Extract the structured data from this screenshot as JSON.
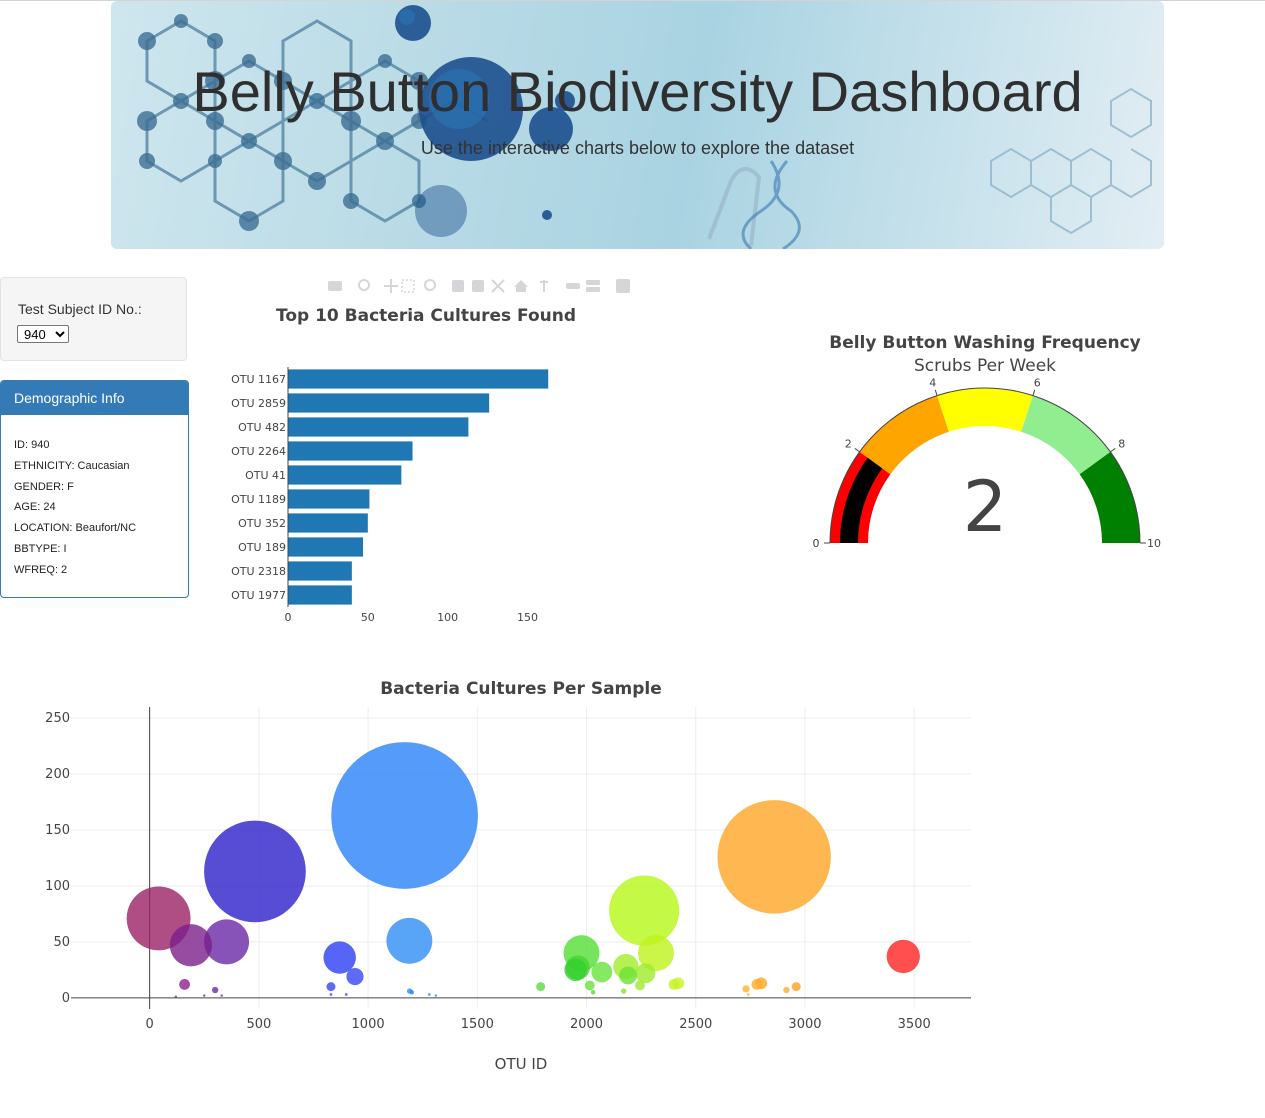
{
  "header": {
    "title": "Belly Button Biodiversity Dashboard",
    "subtitle": "Use the interactive charts below to explore the dataset"
  },
  "selector": {
    "label": "Test Subject ID No.:",
    "selected": "940"
  },
  "demographics": {
    "title": "Demographic Info",
    "rows": [
      "ID: 940",
      "ETHNICITY: Caucasian",
      "GENDER: F",
      "AGE: 24",
      "LOCATION: Beaufort/NC",
      "BBTYPE: I",
      "WFREQ: 2"
    ]
  },
  "colors": {
    "bar": "#1f77b4",
    "panel": "#337ab7",
    "gauge_needle": "#000000",
    "gauge_value_track": "#ff0000"
  },
  "chart_data": [
    {
      "type": "bar",
      "orientation": "horizontal",
      "title": "Top 10 Bacteria Cultures Found",
      "categories": [
        "OTU 1167",
        "OTU 2859",
        "OTU 482",
        "OTU 2264",
        "OTU 41",
        "OTU 1189",
        "OTU 352",
        "OTU 189",
        "OTU 2318",
        "OTU 1977"
      ],
      "values": [
        163,
        126,
        113,
        78,
        71,
        51,
        50,
        47,
        40,
        40
      ],
      "xticks": [
        0,
        50,
        100,
        150
      ],
      "xlim": [
        0,
        171
      ]
    },
    {
      "type": "gauge",
      "title": "Belly Button Washing Frequency",
      "subtitle": "Scrubs Per Week",
      "value": 2,
      "range": [
        0,
        10
      ],
      "ticks": [
        0,
        2,
        4,
        6,
        8,
        10
      ],
      "steps": [
        {
          "range": [
            0,
            2
          ],
          "color": "#ff0000"
        },
        {
          "range": [
            2,
            4
          ],
          "color": "#ffa500"
        },
        {
          "range": [
            4,
            6
          ],
          "color": "#ffff00"
        },
        {
          "range": [
            6,
            8
          ],
          "color": "#90ee90"
        },
        {
          "range": [
            8,
            10
          ],
          "color": "#008000"
        }
      ]
    },
    {
      "type": "scatter",
      "mode": "bubble",
      "title": "Bacteria Cultures Per Sample",
      "xlabel": "OTU ID",
      "ylabel": "",
      "xticks": [
        0,
        500,
        1000,
        1500,
        2000,
        2500,
        3000,
        3500
      ],
      "yticks": [
        0,
        50,
        100,
        150,
        200,
        250
      ],
      "xlim": [
        -360,
        3760
      ],
      "ylim": [
        -10,
        260
      ],
      "grid": true,
      "points": [
        {
          "x": 41,
          "y": 71,
          "color": "#9b2167"
        },
        {
          "x": 189,
          "y": 47,
          "color": "#7a1f8a"
        },
        {
          "x": 352,
          "y": 50,
          "color": "#6a28a8"
        },
        {
          "x": 482,
          "y": 113,
          "color": "#2d1fc9"
        },
        {
          "x": 870,
          "y": 36,
          "color": "#2c3ef2"
        },
        {
          "x": 940,
          "y": 19,
          "color": "#3446f2"
        },
        {
          "x": 1167,
          "y": 163,
          "color": "#2a82f7"
        },
        {
          "x": 1189,
          "y": 51,
          "color": "#2f8df5"
        },
        {
          "x": 1977,
          "y": 40,
          "color": "#55dd36"
        },
        {
          "x": 1960,
          "y": 27,
          "color": "#45d532"
        },
        {
          "x": 1950,
          "y": 25,
          "color": "#34cf2e"
        },
        {
          "x": 2070,
          "y": 23,
          "color": "#66e43b"
        },
        {
          "x": 2180,
          "y": 28,
          "color": "#a2ee2a"
        },
        {
          "x": 2264,
          "y": 78,
          "color": "#b5f717"
        },
        {
          "x": 2318,
          "y": 40,
          "color": "#bff31c"
        },
        {
          "x": 2270,
          "y": 22,
          "color": "#9cec2a"
        },
        {
          "x": 2190,
          "y": 20,
          "color": "#6ee233"
        },
        {
          "x": 2859,
          "y": 126,
          "color": "#ffa526"
        },
        {
          "x": 3450,
          "y": 37,
          "color": "#ff2323"
        },
        {
          "x": 2800,
          "y": 13,
          "color": "#ffa826"
        },
        {
          "x": 2780,
          "y": 12,
          "color": "#ffad2a"
        },
        {
          "x": 2960,
          "y": 10,
          "color": "#ff9d24"
        },
        {
          "x": 2730,
          "y": 8,
          "color": "#ffb02a"
        },
        {
          "x": 2915,
          "y": 7,
          "color": "#ffae2a"
        },
        {
          "x": 1790,
          "y": 10,
          "color": "#58dd3c"
        },
        {
          "x": 2400,
          "y": 12,
          "color": "#c5f21d"
        },
        {
          "x": 2420,
          "y": 13,
          "color": "#c9f221"
        },
        {
          "x": 2015,
          "y": 11,
          "color": "#66e43b"
        },
        {
          "x": 2245,
          "y": 11,
          "color": "#9cec2a"
        },
        {
          "x": 2170,
          "y": 6,
          "color": "#7ee532"
        },
        {
          "x": 2030,
          "y": 5,
          "color": "#55dd36"
        },
        {
          "x": 160,
          "y": 12,
          "color": "#8f2090"
        },
        {
          "x": 300,
          "y": 7,
          "color": "#6a28a8"
        },
        {
          "x": 830,
          "y": 10,
          "color": "#3446f2"
        },
        {
          "x": 1190,
          "y": 6,
          "color": "#2f8df5"
        },
        {
          "x": 1200,
          "y": 5,
          "color": "#2a82f7"
        },
        {
          "x": 1280,
          "y": 3,
          "color": "#2a82f7"
        },
        {
          "x": 1310,
          "y": 2,
          "color": "#2a82f7"
        },
        {
          "x": 900,
          "y": 3,
          "color": "#3446f2"
        },
        {
          "x": 830,
          "y": 3,
          "color": "#3446f2"
        },
        {
          "x": 250,
          "y": 2,
          "color": "#6a28a8"
        },
        {
          "x": 330,
          "y": 2,
          "color": "#6a28a8"
        },
        {
          "x": 120,
          "y": 1,
          "color": "#8f2090"
        },
        {
          "x": 2740,
          "y": 3,
          "color": "#ffb02a"
        }
      ]
    }
  ]
}
